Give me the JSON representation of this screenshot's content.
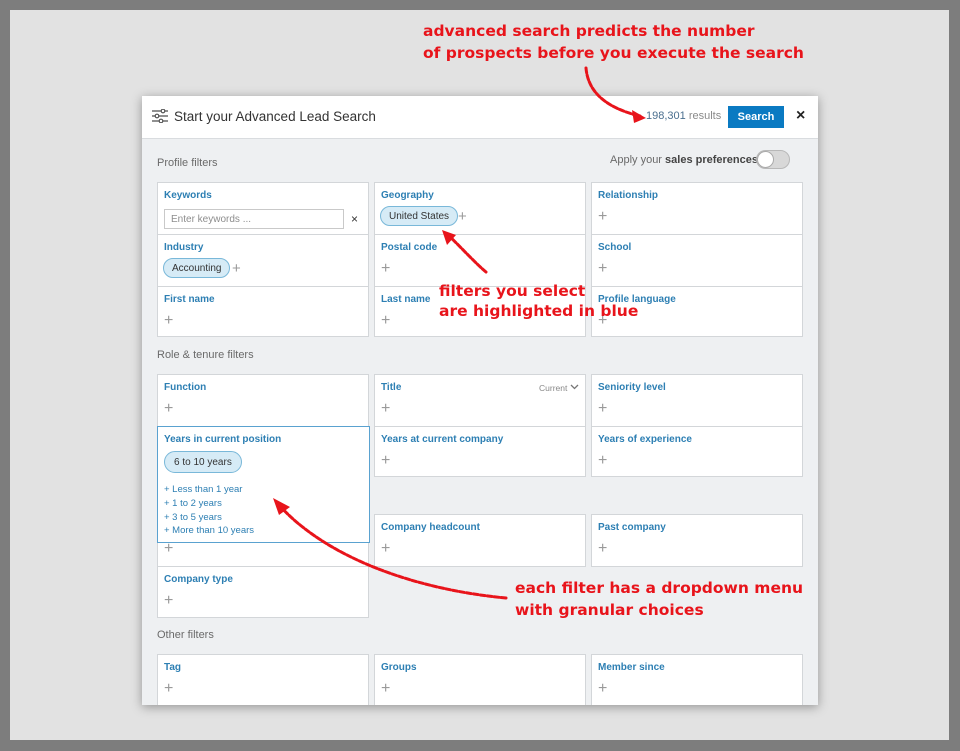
{
  "annotations": {
    "top_line1": "advanced search predicts the number",
    "top_line2": "of prospects before you execute the search",
    "mid_line1": "filters you select",
    "mid_line2": "are highlighted in blue",
    "bottom_line1": "each filter has a dropdown menu",
    "bottom_line2": "with granular choices"
  },
  "header": {
    "icon": "sliders-icon",
    "title": "Start your Advanced Lead Search",
    "results_count": "198,301",
    "results_suffix": "results",
    "search_label": "Search",
    "close_label": "×"
  },
  "sections": {
    "profile": "Profile filters",
    "role": "Role & tenure filters",
    "other": "Other filters"
  },
  "sales_prefs": {
    "prefix": "Apply your",
    "bold": "sales preferences",
    "enabled": false
  },
  "filters": {
    "keywords": {
      "title": "Keywords",
      "placeholder": "Enter keywords ...",
      "clear": "×"
    },
    "geography": {
      "title": "Geography",
      "selected": "United States"
    },
    "relationship": {
      "title": "Relationship"
    },
    "industry": {
      "title": "Industry",
      "selected": "Accounting"
    },
    "postal_code": {
      "title": "Postal code"
    },
    "school": {
      "title": "School"
    },
    "first_name": {
      "title": "First name"
    },
    "last_name": {
      "title": "Last name"
    },
    "profile_language": {
      "title": "Profile language"
    },
    "function": {
      "title": "Function"
    },
    "title": {
      "title": "Title",
      "dropdown": "Current"
    },
    "seniority": {
      "title": "Seniority level"
    },
    "years_position": {
      "title": "Years in current position",
      "selected": "6 to 10 years",
      "options": [
        "+ Less than 1 year",
        "+ 1 to 2 years",
        "+ 3 to 5 years",
        "+ More than 10 years"
      ]
    },
    "years_company": {
      "title": "Years at current company"
    },
    "years_experience": {
      "title": "Years of experience"
    },
    "company_headcount": {
      "title": "Company headcount"
    },
    "past_company": {
      "title": "Past company"
    },
    "company_type": {
      "title": "Company type"
    },
    "tag": {
      "title": "Tag"
    },
    "groups": {
      "title": "Groups"
    },
    "member_since": {
      "title": "Member since"
    }
  },
  "plus_glyph": "+",
  "colors": {
    "accent": "#0a7ac2",
    "link": "#2d7fb3",
    "annotation": "#e8141b",
    "pill": "#d6ebf6"
  }
}
